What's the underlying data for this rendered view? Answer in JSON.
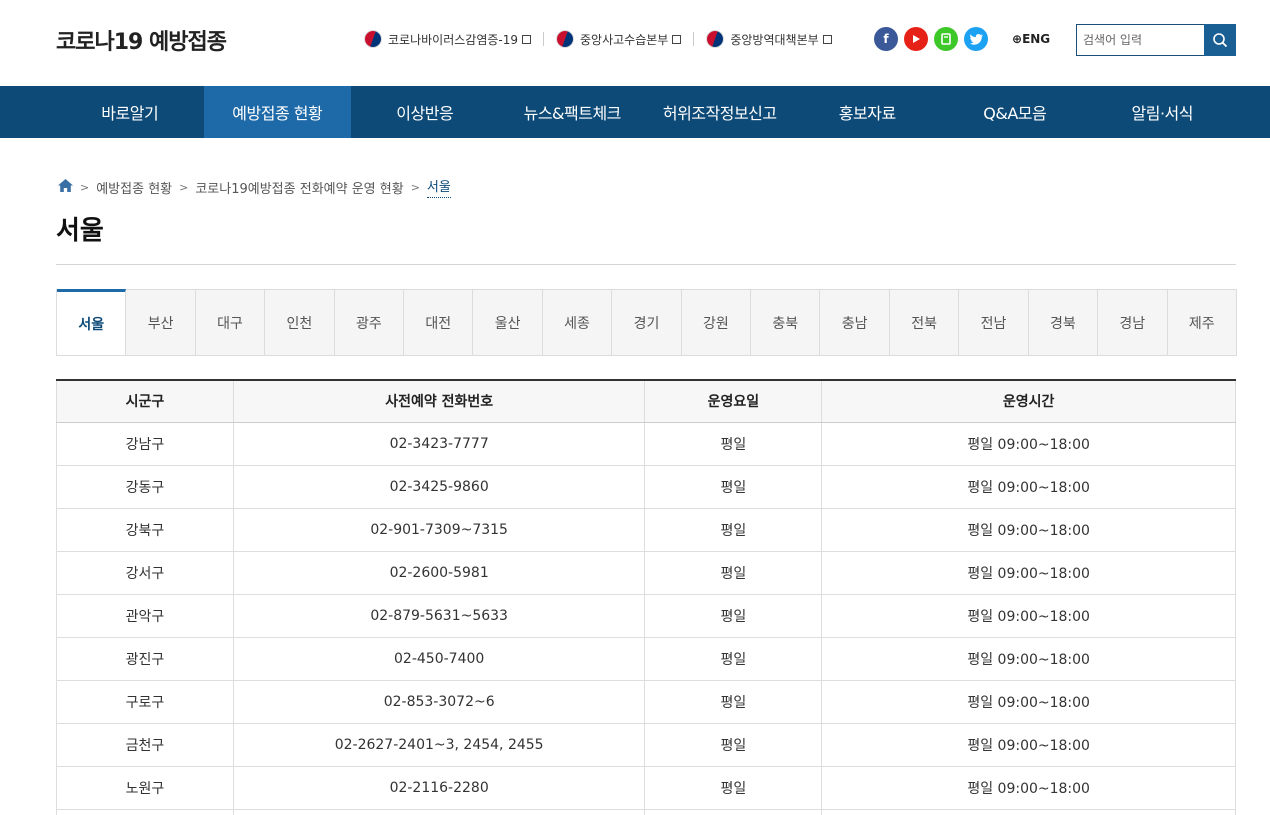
{
  "header": {
    "logo": "코로나19 예방접종",
    "links": [
      {
        "label": "코로나바이러스감염증-19"
      },
      {
        "label": "중앙사고수습본부"
      },
      {
        "label": "중앙방역대책본부"
      }
    ],
    "eng": "ENG",
    "search_placeholder": "검색어 입력"
  },
  "nav": {
    "items": [
      {
        "label": "바로알기"
      },
      {
        "label": "예방접종 현황",
        "active": true
      },
      {
        "label": "이상반응"
      },
      {
        "label": "뉴스&팩트체크"
      },
      {
        "label": "허위조작정보신고"
      },
      {
        "label": "홍보자료"
      },
      {
        "label": "Q&A모음"
      },
      {
        "label": "알림·서식"
      }
    ]
  },
  "breadcrumb": {
    "items": [
      "예방접종 현황",
      "코로나19예방접종 전화예약 운영 현황"
    ],
    "current": "서울"
  },
  "page_title": "서울",
  "regions": {
    "active": "서울",
    "items": [
      "서울",
      "부산",
      "대구",
      "인천",
      "광주",
      "대전",
      "울산",
      "세종",
      "경기",
      "강원",
      "충북",
      "충남",
      "전북",
      "전남",
      "경북",
      "경남",
      "제주"
    ]
  },
  "table": {
    "headers": [
      "시군구",
      "사전예약 전화번호",
      "운영요일",
      "운영시간"
    ],
    "rows": [
      [
        "강남구",
        "02-3423-7777",
        "평일",
        "평일 09:00~18:00"
      ],
      [
        "강동구",
        "02-3425-9860",
        "평일",
        "평일 09:00~18:00"
      ],
      [
        "강북구",
        "02-901-7309~7315",
        "평일",
        "평일 09:00~18:00"
      ],
      [
        "강서구",
        "02-2600-5981",
        "평일",
        "평일 09:00~18:00"
      ],
      [
        "관악구",
        "02-879-5631~5633",
        "평일",
        "평일 09:00~18:00"
      ],
      [
        "광진구",
        "02-450-7400",
        "평일",
        "평일 09:00~18:00"
      ],
      [
        "구로구",
        "02-853-3072~6",
        "평일",
        "평일 09:00~18:00"
      ],
      [
        "금천구",
        "02-2627-2401~3, 2454, 2455",
        "평일",
        "평일 09:00~18:00"
      ],
      [
        "노원구",
        "02-2116-2280",
        "평일",
        "평일 09:00~18:00"
      ],
      [
        "",
        "",
        "",
        ""
      ]
    ]
  },
  "colors": {
    "nav_bg": "#0d4a78",
    "nav_active": "#1e6aa8",
    "accent": "#0d4a78"
  }
}
